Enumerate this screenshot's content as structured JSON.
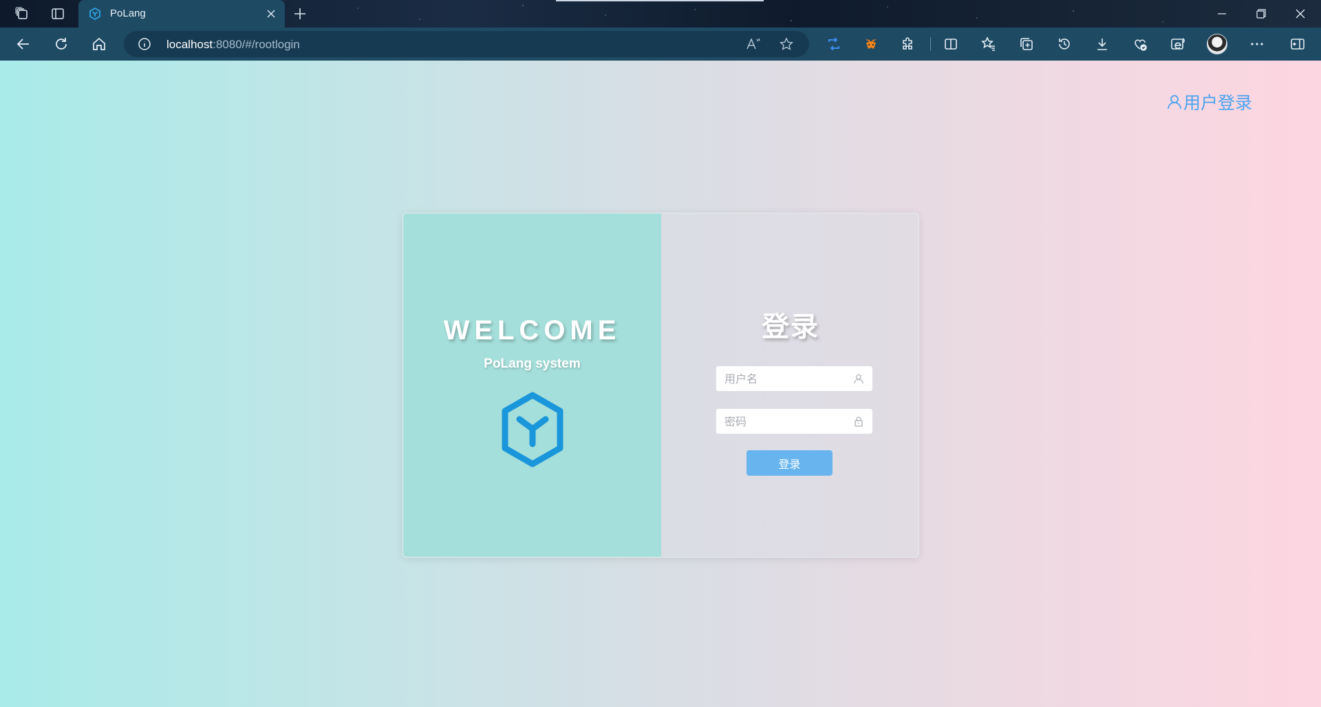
{
  "browser": {
    "tab_title": "PoLang",
    "url_host": "localhost",
    "url_rest": ":8080/#/rootlogin"
  },
  "header": {
    "user_login_label": "用户登录"
  },
  "welcome_panel": {
    "heading": "WELCOME",
    "subtitle": "PoLang system"
  },
  "login_form": {
    "title": "登录",
    "username_placeholder": "用户名",
    "password_placeholder": "密码",
    "submit_label": "登录"
  },
  "colors": {
    "accent": "#4aa3f0",
    "logo_blue": "#1a96db",
    "button": "#67b4ee",
    "left_panel": "#a5dfdb"
  }
}
